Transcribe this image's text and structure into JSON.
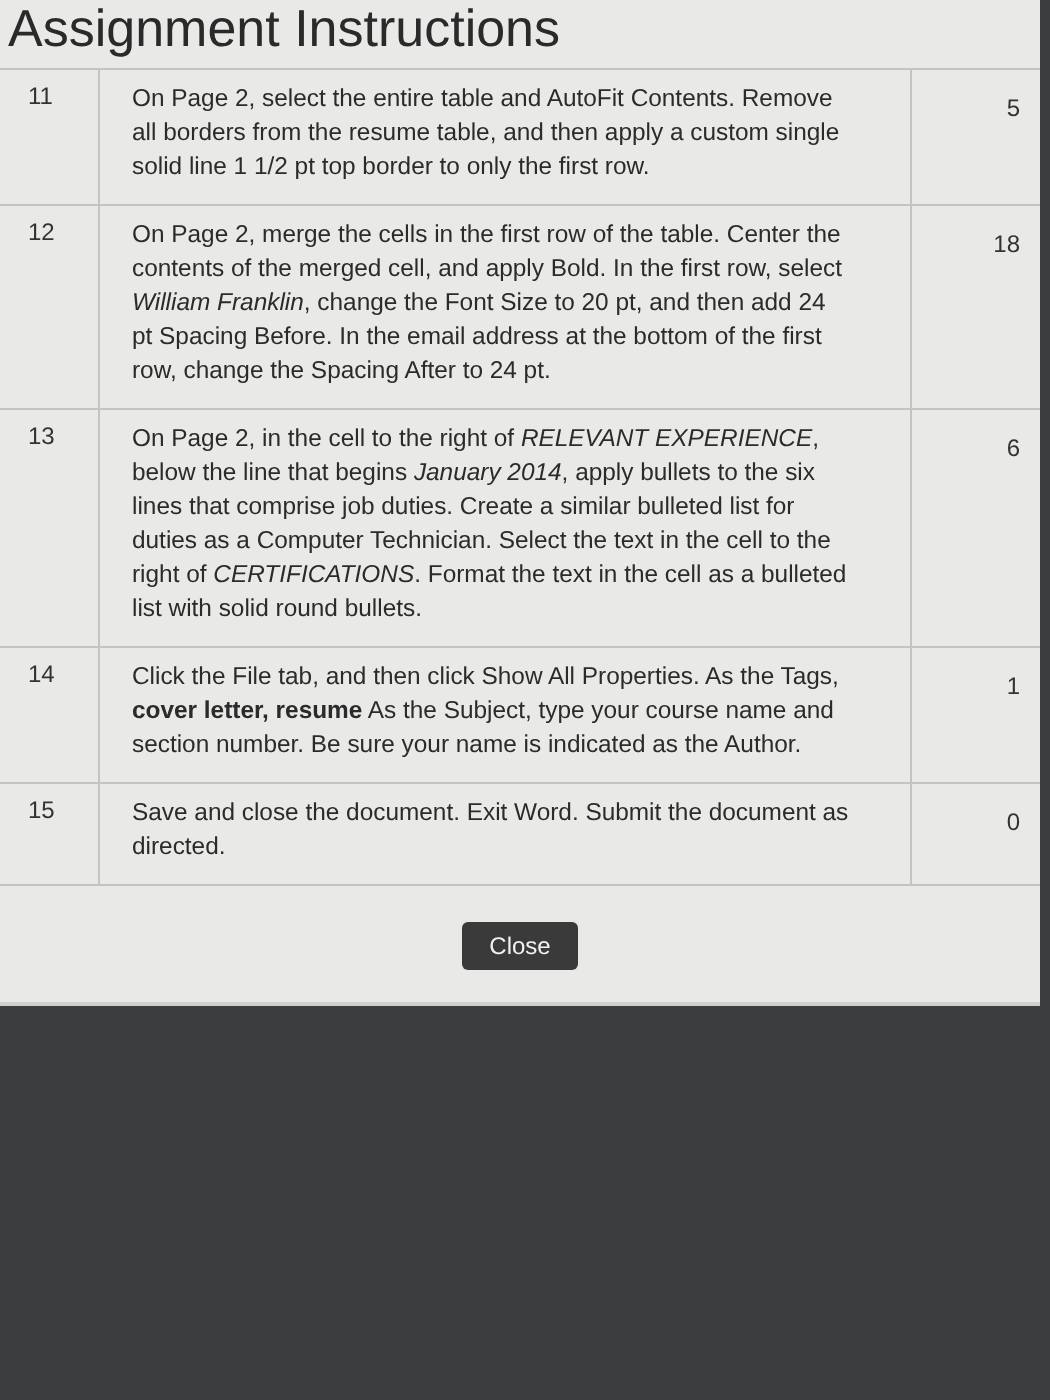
{
  "dialog": {
    "title": "Assignment Instructions",
    "steps": [
      {
        "number": "11",
        "instruction": "On Page 2, select the entire table and AutoFit Contents. Remove all borders from the resume table, and then apply a custom single solid line 1 1/2 pt top border to only the first row.",
        "points": "5"
      },
      {
        "number": "12",
        "instruction": "On Page 2, merge the cells in the first row of the table. Center the contents of the merged cell, and apply Bold. In the first row, select *William Franklin*, change the Font Size to 20 pt, and then add 24 pt Spacing Before. In the email address at the bottom of the first row, change the Spacing After to 24 pt.",
        "points": "18"
      },
      {
        "number": "13",
        "instruction": "On Page 2, in the cell to the right of *RELEVANT EXPERIENCE*, below the line that begins *January 2014*, apply bullets to the six lines that comprise job duties. Create a similar bulleted list for duties as a Computer Technician. Select the text in the cell to the right of *CERTIFICATIONS*. Format the text in the cell as a bulleted list with solid round bullets.",
        "points": "6"
      },
      {
        "number": "14",
        "instruction": "Click the File tab, and then click Show All Properties. As the Tags, **cover letter, resume** As the Subject, type your course name and section number. Be sure your name is indicated as the Author.",
        "points": "1"
      },
      {
        "number": "15",
        "instruction": "Save and close the document. Exit Word. Submit the document as directed.",
        "points": "0"
      }
    ],
    "close_button": "Close"
  }
}
